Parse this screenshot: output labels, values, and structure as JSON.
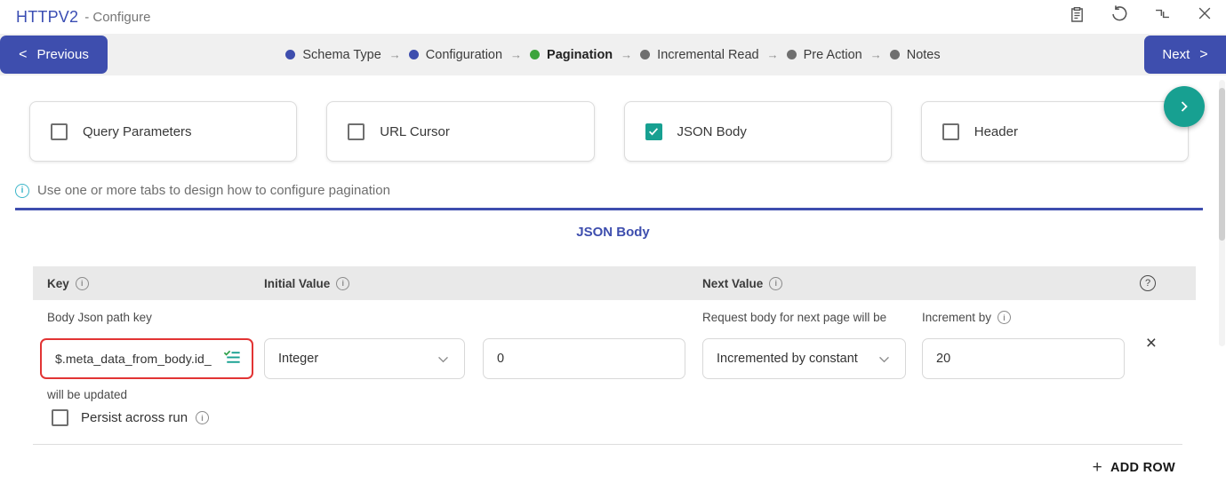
{
  "window": {
    "title": "HTTPV2",
    "subtitle": "- Configure"
  },
  "nav": {
    "previous_label": "Previous",
    "next_label": "Next",
    "prev_chevron": "<",
    "next_chevron": ">",
    "arrow": "→",
    "steps": [
      {
        "label": "Schema Type",
        "state": "done"
      },
      {
        "label": "Configuration",
        "state": "done"
      },
      {
        "label": "Pagination",
        "state": "active"
      },
      {
        "label": "Incremental Read",
        "state": "pending"
      },
      {
        "label": "Pre Action",
        "state": "pending"
      },
      {
        "label": "Notes",
        "state": "pending"
      }
    ]
  },
  "pagination_tabs": [
    {
      "label": "Query Parameters",
      "checked": false
    },
    {
      "label": "URL Cursor",
      "checked": false
    },
    {
      "label": "JSON Body",
      "checked": true
    },
    {
      "label": "Header",
      "checked": false
    }
  ],
  "info": {
    "text": "Use one or more tabs to design how to configure pagination"
  },
  "section": {
    "title": "JSON Body"
  },
  "table": {
    "headers": {
      "key": "Key",
      "initial": "Initial Value",
      "next": "Next Value"
    },
    "row": {
      "key_label": "Body Json path key",
      "key_value": "$.meta_data_from_body.id_",
      "key_note": "will be updated",
      "initial_type": "Integer",
      "initial_value": "0",
      "next_label": "Request body for next page will be",
      "next_strategy": "Incremented by constant",
      "increment_label": "Increment by",
      "increment_value": "20",
      "persist_label": "Persist across run"
    },
    "add_row_label": "ADD ROW"
  },
  "glyphs": {
    "plus": "+",
    "row_close": "×",
    "help": "?",
    "info": "i"
  },
  "colors": {
    "accent_indigo": "#3e4eae",
    "accent_teal": "#17a091",
    "step_active_green": "#3ca43c",
    "step_pending_gray": "#6f6f6f",
    "highlight_red": "#e23434",
    "info_cyan": "#3bb5c9"
  }
}
